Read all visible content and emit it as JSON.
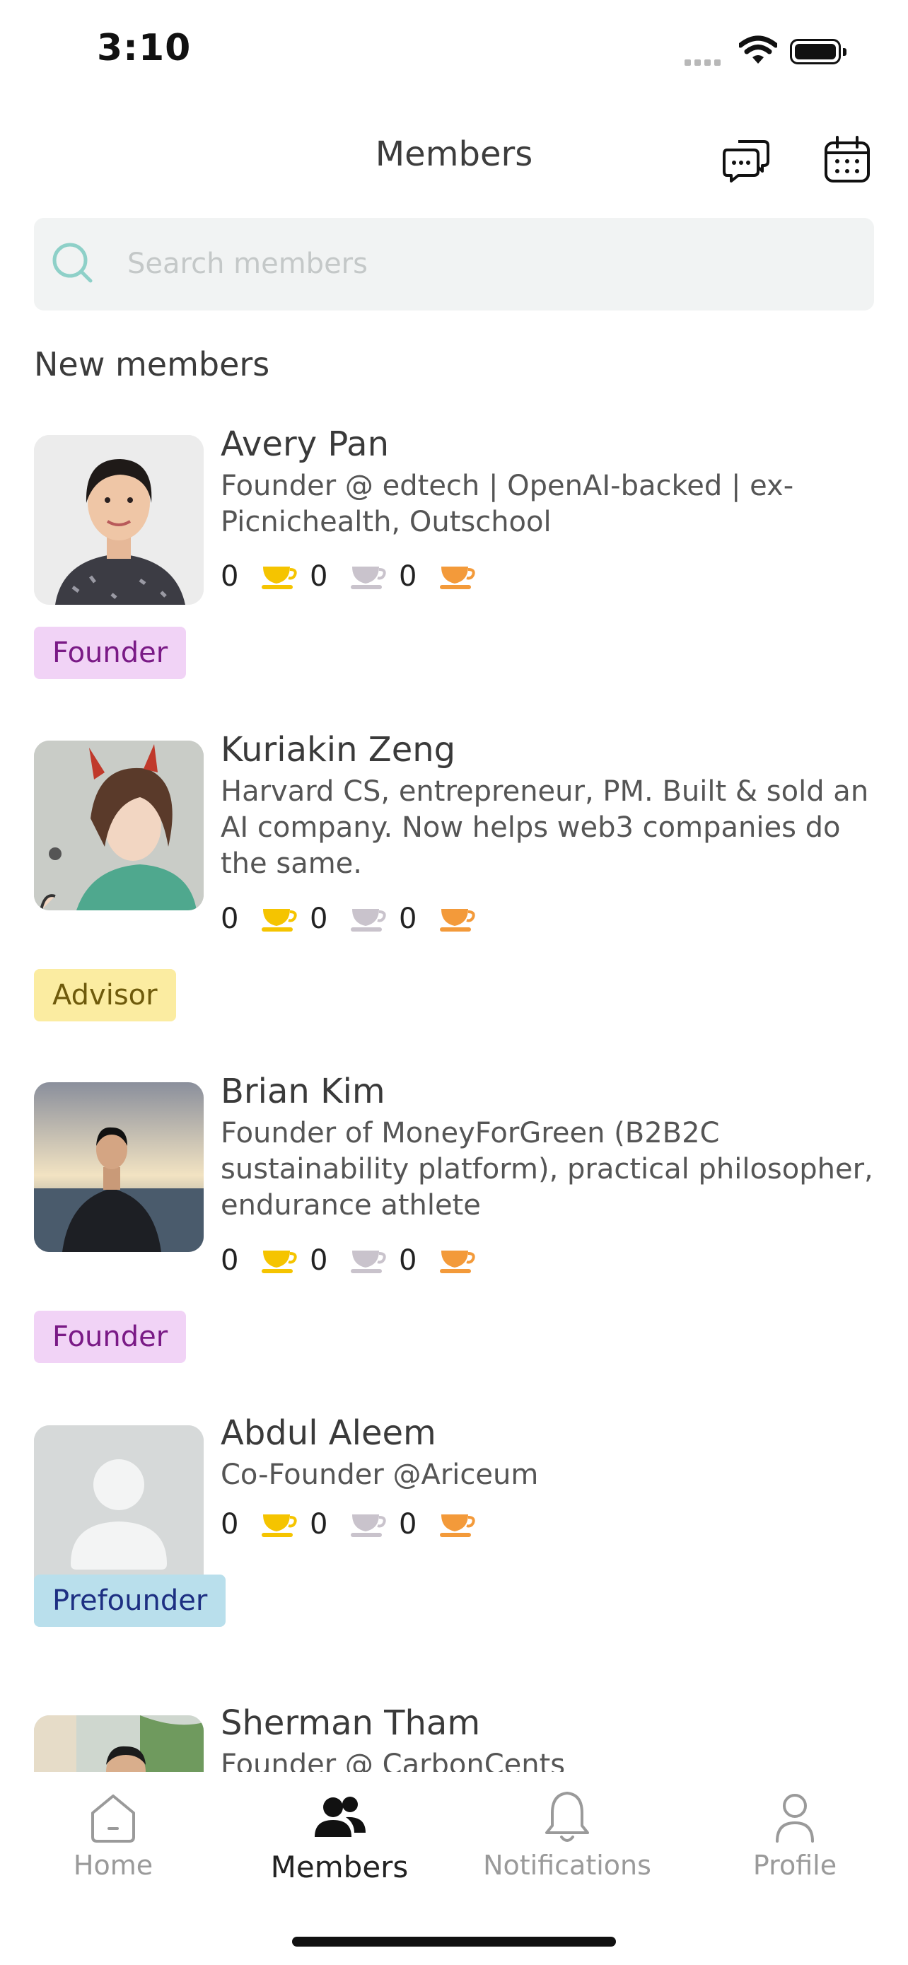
{
  "status_bar": {
    "time": "3:10"
  },
  "header": {
    "title": "Members"
  },
  "search": {
    "placeholder": "Search members"
  },
  "section_title": "New members",
  "members": [
    {
      "name": "Avery Pan",
      "bio": "Founder @ edtech | OpenAI-backed | ex-Picnichealth, Outschool",
      "stats": [
        "0",
        "0",
        "0"
      ],
      "badge": "Founder"
    },
    {
      "name": "Kuriakin Zeng",
      "bio": "Harvard CS, entrepreneur, PM. Built & sold an AI company. Now helps web3 companies do the same.",
      "stats": [
        "0",
        "0",
        "0"
      ],
      "badge": "Advisor"
    },
    {
      "name": "Brian Kim",
      "bio": "Founder of MoneyForGreen (B2B2C sustainability platform), practical philosopher, endurance athlete",
      "stats": [
        "0",
        "0",
        "0"
      ],
      "badge": "Founder"
    },
    {
      "name": "Abdul Aleem",
      "bio": "Co-Founder @Ariceum",
      "stats": [
        "0",
        "0",
        "0"
      ],
      "badge": "Prefounder"
    },
    {
      "name": "Sherman Tham",
      "bio": "Founder @ CarbonCents",
      "stats": [],
      "badge": ""
    }
  ],
  "cup_colors": {
    "gold": "#f5c400",
    "silver": "#c9c3cc",
    "bronze": "#f39a3a"
  },
  "tabs": [
    {
      "label": "Home",
      "icon": "home-icon",
      "active": false
    },
    {
      "label": "Members",
      "icon": "people-icon",
      "active": true
    },
    {
      "label": "Notifications",
      "icon": "bell-icon",
      "active": false
    },
    {
      "label": "Profile",
      "icon": "user-icon",
      "active": false
    }
  ]
}
